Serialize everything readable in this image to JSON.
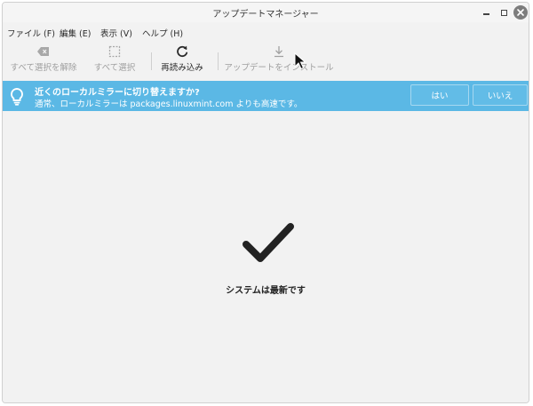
{
  "window": {
    "title": "アップデートマネージャー"
  },
  "menu": [
    "ファイル (F)",
    "編集 (E)",
    "表示 (V)",
    "ヘルプ (H)"
  ],
  "toolbar": {
    "clear_selection": "すべて選択を解除",
    "select_all": "すべて選択",
    "refresh": "再読み込み",
    "install": "アップデートをインストール"
  },
  "infobar": {
    "title": "近くのローカルミラーに切り替えますか?",
    "body": "通常、ローカルミラーは packages.linuxmint.com よりも高速です。",
    "yes": "はい",
    "no": "いいえ",
    "color": "#5bb8e5"
  },
  "status": {
    "message": "システムは最新です"
  }
}
